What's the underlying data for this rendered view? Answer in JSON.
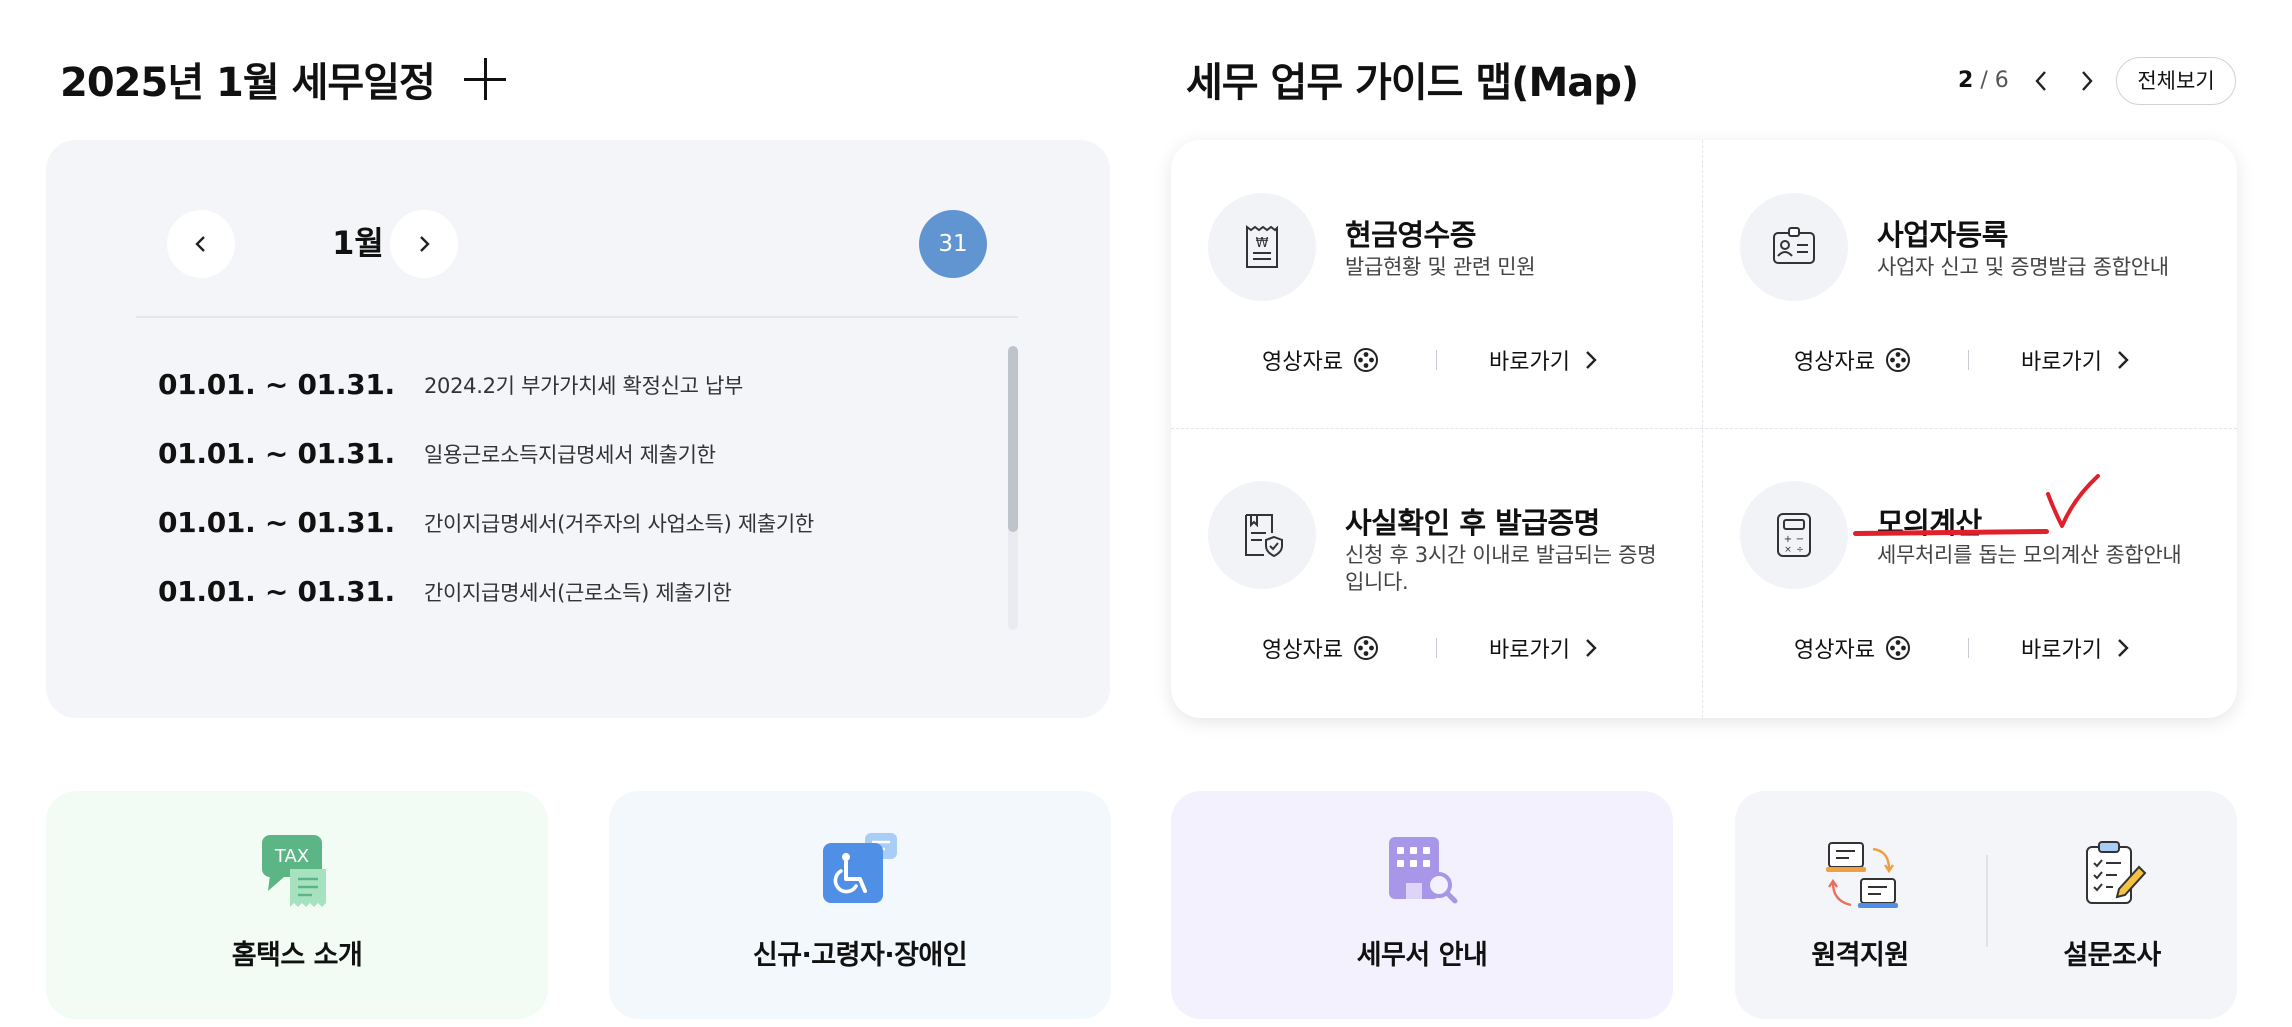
{
  "schedule": {
    "title": "2025년 1월 세무일정",
    "month": "1월",
    "day_badge": "31",
    "items": [
      {
        "date": "01.01. ~ 01.31.",
        "text": "2024.2기 부가가치세 확정신고 납부"
      },
      {
        "date": "01.01. ~ 01.31.",
        "text": "일용근로소득지급명세서 제출기한"
      },
      {
        "date": "01.01. ~ 01.31.",
        "text": "간이지급명세서(거주자의 사업소득) 제출기한"
      },
      {
        "date": "01.01. ~ 01.31.",
        "text": "간이지급명세서(근로소득) 제출기한"
      }
    ]
  },
  "guide_map": {
    "title": "세무 업무 가이드 맵(Map)",
    "page_current": "2",
    "page_separator": "/",
    "page_total": "6",
    "view_all": "전체보기",
    "cells": [
      {
        "title": "현금영수증",
        "desc": "발급현황 및 관련 민원",
        "video": "영상자료",
        "go": "바로가기",
        "icon": "receipt-icon"
      },
      {
        "title": "사업자등록",
        "desc": "사업자 신고 및 증명발급 종합안내",
        "video": "영상자료",
        "go": "바로가기",
        "icon": "id-card-icon"
      },
      {
        "title": "사실확인 후 발급증명",
        "desc": "신청 후 3시간 이내로 발급되는 증명입니다.",
        "video": "영상자료",
        "go": "바로가기",
        "icon": "certificate-icon"
      },
      {
        "title": "모의계산",
        "desc": "세무처리를 돕는 모의계산 종합안내",
        "video": "영상자료",
        "go": "바로가기",
        "icon": "calculator-icon"
      }
    ]
  },
  "quick_links": {
    "hometax": "홈택스 소개",
    "accessibility": "신규·고령자·장애인",
    "tax_office": "세무서 안내",
    "remote_support": "원격지원",
    "survey": "설문조사",
    "tax_badge": "TAX"
  },
  "colors": {
    "accent": "#6095d2",
    "annotation": "#e0202a",
    "hometax_bg": "#f3fbf5",
    "access_bg": "#f2f8fc",
    "office_bg": "#f3f1fd",
    "support_bg": "#f4f5f9"
  }
}
